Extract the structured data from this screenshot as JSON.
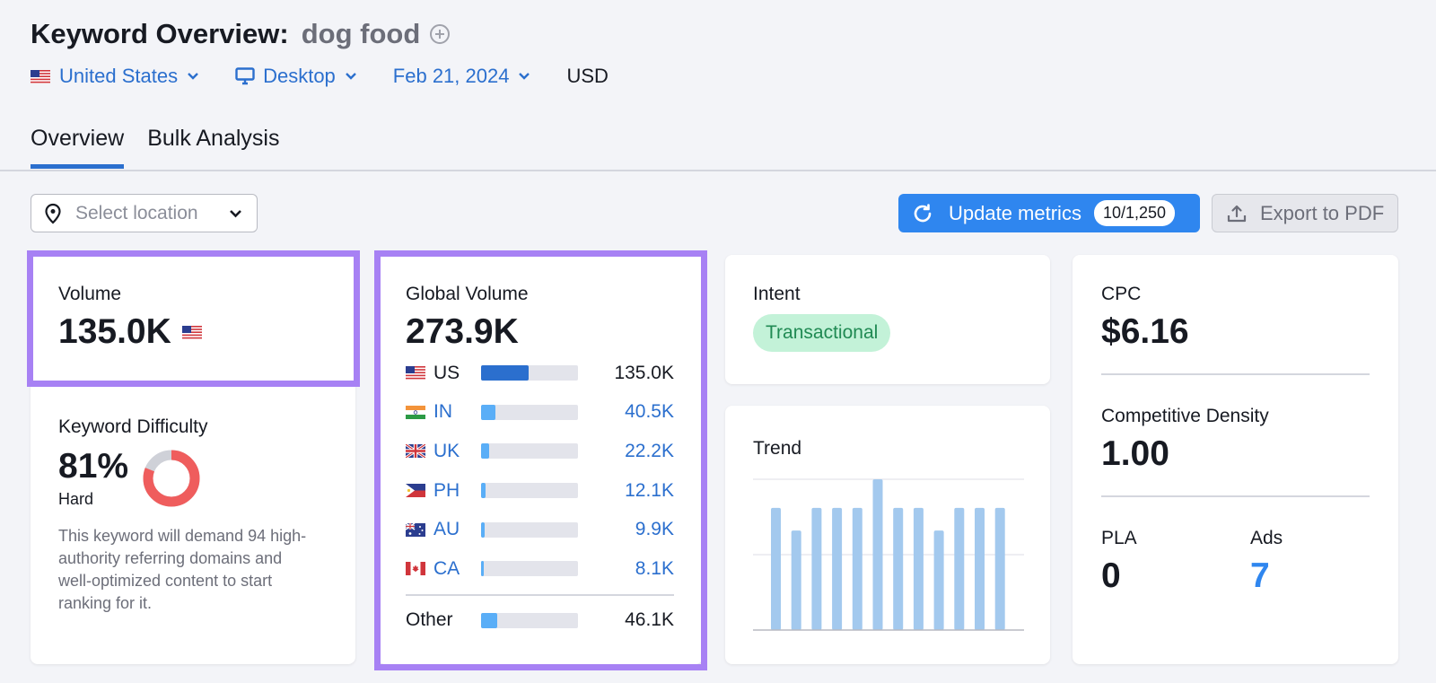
{
  "header": {
    "title": "Keyword Overview:",
    "keyword": "dog food",
    "filters": {
      "country": "United States",
      "device": "Desktop",
      "date": "Feb 21, 2024",
      "currency": "USD"
    }
  },
  "tabs": [
    {
      "label": "Overview",
      "active": true
    },
    {
      "label": "Bulk Analysis",
      "active": false
    }
  ],
  "toolbar": {
    "location_placeholder": "Select location",
    "update_label": "Update metrics",
    "update_count": "10/1,250",
    "export_label": "Export to PDF"
  },
  "volume": {
    "label": "Volume",
    "value": "135.0K"
  },
  "keyword_difficulty": {
    "label": "Keyword Difficulty",
    "value": "81%",
    "level": "Hard",
    "percent": 81,
    "description": "This keyword will demand 94 high-authority referring domains and well-optimized content to start ranking for it."
  },
  "global_volume": {
    "label": "Global Volume",
    "value": "273.9K",
    "countries": [
      {
        "code": "US",
        "value": "135.0K",
        "share": 0.49
      },
      {
        "code": "IN",
        "value": "40.5K",
        "share": 0.15
      },
      {
        "code": "UK",
        "value": "22.2K",
        "share": 0.08
      },
      {
        "code": "PH",
        "value": "12.1K",
        "share": 0.045
      },
      {
        "code": "AU",
        "value": "9.9K",
        "share": 0.036
      },
      {
        "code": "CA",
        "value": "8.1K",
        "share": 0.03
      }
    ],
    "other": {
      "label": "Other",
      "value": "46.1K",
      "share": 0.17
    }
  },
  "intent": {
    "label": "Intent",
    "value": "Transactional"
  },
  "trend": {
    "label": "Trend",
    "chart_data": {
      "type": "bar",
      "categories": [
        "1",
        "2",
        "3",
        "4",
        "5",
        "6",
        "7",
        "8",
        "9",
        "10",
        "11",
        "12"
      ],
      "values": [
        0.81,
        0.66,
        0.81,
        0.81,
        0.81,
        1.0,
        0.81,
        0.81,
        0.66,
        0.81,
        0.81,
        0.81
      ],
      "ylim": [
        0,
        1
      ]
    }
  },
  "cpc": {
    "label": "CPC",
    "value": "$6.16"
  },
  "competitive_density": {
    "label": "Competitive Density",
    "value": "1.00"
  },
  "pla": {
    "label": "PLA",
    "value": "0"
  },
  "ads": {
    "label": "Ads",
    "value": "7"
  },
  "colors": {
    "link": "#2b6fce",
    "button": "#2f86ef",
    "highlight": "#a781f4",
    "kd_red": "#ef5d5d",
    "trend_bar": "#a3c9ee",
    "us_bar": "#2b6fce",
    "other_bar": "#5aaef7"
  }
}
